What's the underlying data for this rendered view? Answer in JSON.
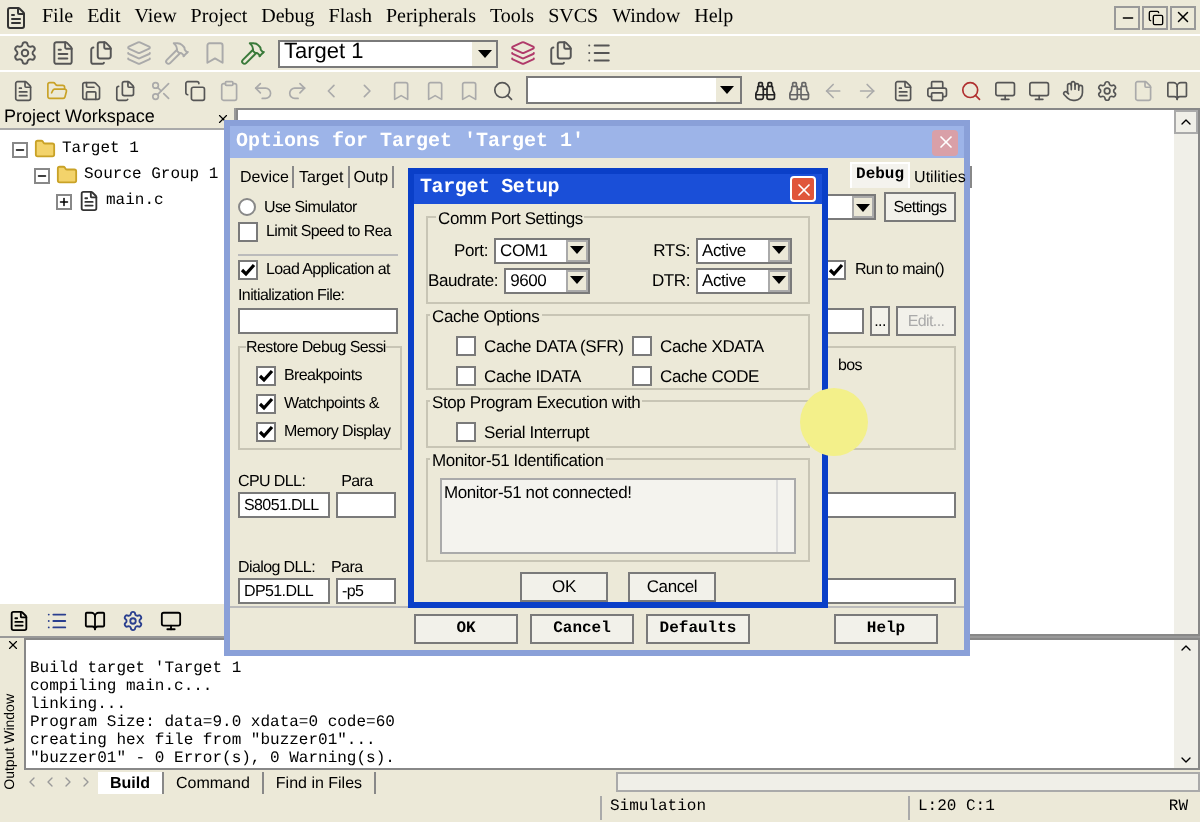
{
  "menu": [
    "File",
    "Edit",
    "View",
    "Project",
    "Debug",
    "Flash",
    "Peripherals",
    "Tools",
    "SVCS",
    "Window",
    "Help"
  ],
  "target_select": {
    "value": "Target 1"
  },
  "workspace": {
    "title": "Project Workspace",
    "tree": [
      {
        "label": "Target 1",
        "expanded": true,
        "children": [
          {
            "label": "Source Group 1",
            "expanded": true,
            "children": [
              {
                "label": "main.c",
                "expanded": false
              }
            ]
          }
        ]
      }
    ]
  },
  "options_dialog": {
    "title": "Options for Target 'Target 1'",
    "tabs": [
      {
        "label": "Device",
        "selected": false
      },
      {
        "label": "Target",
        "selected": false
      },
      {
        "label": "Outp",
        "selected": false
      },
      {
        "label": "Debug",
        "selected": true
      },
      {
        "label": "Utilities",
        "selected": false
      }
    ],
    "use_simulator": {
      "label": "Use Simulator",
      "selected": false
    },
    "limit_speed": {
      "label": "Limit Speed to Rea",
      "checked": false
    },
    "load_app": {
      "label": "Load Application at",
      "checked": true
    },
    "init_file_label": "Initialization File:",
    "restore_group": {
      "title": "Restore Debug Sessi",
      "items": [
        {
          "label": "Breakpoints",
          "checked": true
        },
        {
          "label": "Watchpoints &",
          "checked": true
        },
        {
          "label": "Memory Display",
          "checked": true
        }
      ]
    },
    "cpu_dll_label": "CPU DLL:",
    "cpu_param_label": "Para",
    "cpu_dll": "S8051.DLL",
    "dialog_dll_label": "Dialog DLL:",
    "dialog_param_label": "Para",
    "dialog_dll": "DP51.DLL",
    "dialog_param": "-p5",
    "settings_button": "Settings",
    "run_to_main": {
      "label": "Run to main()",
      "checked": true
    },
    "browse_button": "...",
    "edit_button": {
      "label": "Edit...",
      "disabled": true
    },
    "group_text": "bos",
    "buttons": [
      "OK",
      "Cancel",
      "Defaults",
      "Help"
    ]
  },
  "setup_dialog": {
    "title": "Target Setup",
    "comm": {
      "title": "Comm Port Settings",
      "fields": [
        {
          "label": "Port:",
          "value": "COM1"
        },
        {
          "label": "RTS:",
          "value": "Active"
        },
        {
          "label": "Baudrate:",
          "value": "9600"
        },
        {
          "label": "DTR:",
          "value": "Active"
        }
      ]
    },
    "cache": {
      "title": "Cache Options",
      "items": [
        {
          "label": "Cache DATA (SFR)",
          "checked": false
        },
        {
          "label": "Cache XDATA",
          "checked": false
        },
        {
          "label": "Cache IDATA",
          "checked": false
        },
        {
          "label": "Cache CODE",
          "checked": false
        }
      ]
    },
    "stop": {
      "title": "Stop Program Execution with",
      "items": [
        {
          "label": "Serial Interrupt",
          "checked": false
        }
      ]
    },
    "monitor": {
      "title": "Monitor-51 Identification",
      "text": "Monitor-51 not connected!"
    },
    "buttons": [
      "OK",
      "Cancel"
    ]
  },
  "output": {
    "title": "Output Window",
    "lines": [
      "Build target 'Target 1",
      "compiling main.c...",
      "linking...",
      "Program Size: data=9.0 xdata=0 code=60",
      "creating hex file from \"buzzer01\"...",
      "\"buzzer01\" - 0 Error(s), 0 Warning(s)."
    ],
    "tabs": [
      {
        "label": "Build",
        "selected": true
      },
      {
        "label": "Command",
        "selected": false
      },
      {
        "label": "Find in Files",
        "selected": false
      }
    ]
  },
  "status": [
    "Simulation",
    "L:20 C:1",
    "RW"
  ]
}
